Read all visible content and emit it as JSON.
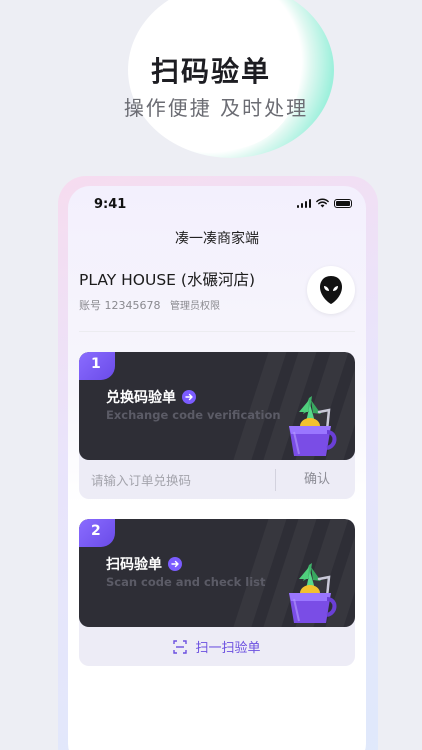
{
  "hero": {
    "title": "扫码验单",
    "subtitle": "操作便捷 及时处理"
  },
  "status_bar": {
    "time": "9:41",
    "icons": [
      "cellular-signal-icon",
      "wifi-icon",
      "battery-icon"
    ]
  },
  "app": {
    "title": "凑一凑商家端"
  },
  "store": {
    "name": "PLAY HOUSE (水碾河店)",
    "account_label": "账号 12345678",
    "permission": "管理员权限",
    "avatar_icon": "alien-avatar-icon"
  },
  "card1": {
    "step": "1",
    "title": "兑换码验单",
    "subtitle": "Exchange code verification",
    "input_placeholder": "请输入订单兑换码",
    "confirm_label": "确认",
    "icon": "drink-cup-icon"
  },
  "card2": {
    "step": "2",
    "title": "扫码验单",
    "subtitle": "Scan code and check list",
    "scan_label": "扫一扫验单",
    "icon": "drink-cup-icon"
  },
  "colors": {
    "accent": "#7b5cff",
    "card_dark": "#2e2e36",
    "hero_glow": "#7de7d0"
  }
}
